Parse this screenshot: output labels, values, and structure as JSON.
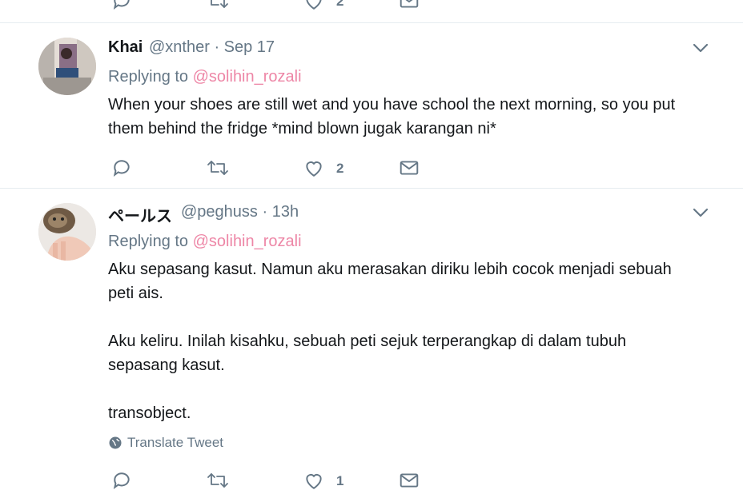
{
  "top_partial": {
    "like_count": "2"
  },
  "tweets": [
    {
      "name": "Khai",
      "handle": "@xnther · Sep 17",
      "reply_prefix": "Replying to",
      "reply_to": "@solihin_rozali",
      "text": "When your shoes are still wet and you have school the next morning, so you put\nthem behind the fridge *mind blown jugak karangan ni*",
      "like_count": "2"
    },
    {
      "name": "ペールス",
      "handle": "@peghuss · 13h",
      "reply_prefix": "Replying to",
      "reply_to": "@solihin_rozali",
      "text": "Aku sepasang kasut. Namun aku merasakan diriku lebih cocok menjadi sebuah\npeti ais.\n\nAku keliru. Inilah kisahku, sebuah peti sejuk terperangkap di dalam tubuh\nsepasang kasut.\n\ntransobject.",
      "translate_label": "Translate Tweet",
      "like_count": "1"
    }
  ],
  "icons": {
    "reply": "reply-icon",
    "retweet": "retweet-icon",
    "like": "heart-icon",
    "dm": "envelope-icon",
    "caret": "chevron-down-icon",
    "globe": "globe-icon"
  },
  "colors": {
    "accent_link": "#e0245e",
    "muted": "#657786",
    "divider": "#e6ecf0"
  }
}
